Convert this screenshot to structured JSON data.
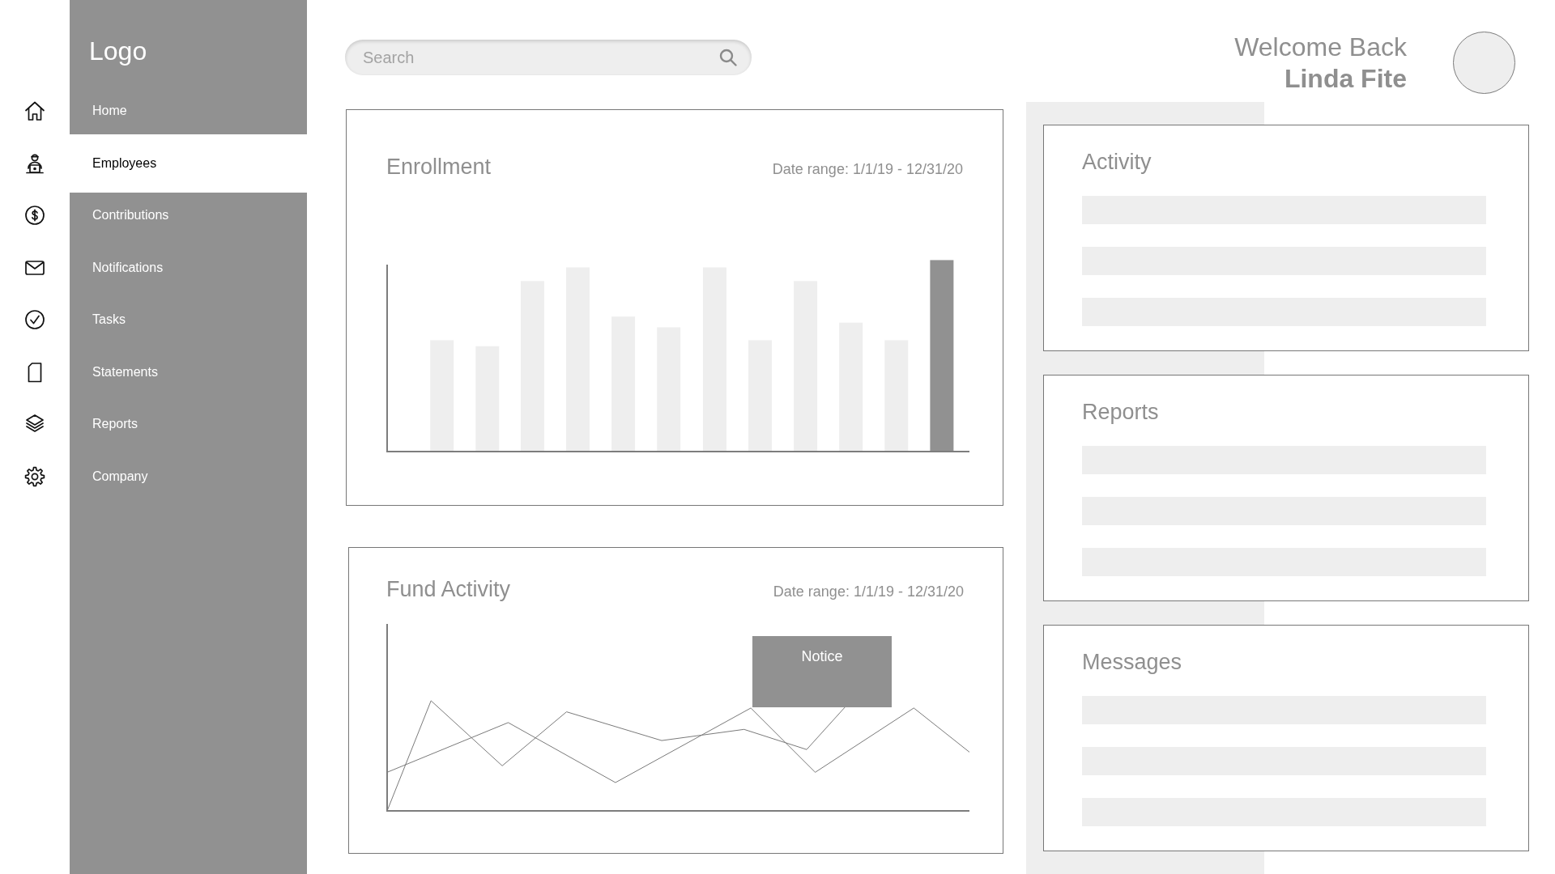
{
  "sidebar": {
    "logo": "Logo",
    "items": [
      {
        "label": "Home",
        "selected": false
      },
      {
        "label": "Employees",
        "selected": true
      },
      {
        "label": "Contributions",
        "selected": false
      },
      {
        "label": "Notifications",
        "selected": false
      },
      {
        "label": "Tasks",
        "selected": false
      },
      {
        "label": "Statements",
        "selected": false
      },
      {
        "label": "Reports",
        "selected": false
      },
      {
        "label": "Company",
        "selected": false
      }
    ]
  },
  "search": {
    "placeholder": "Search"
  },
  "user": {
    "greeting": "Welcome Back",
    "name": "Linda Fite"
  },
  "cards": [
    {
      "kind": "bar",
      "title": "Enrollment",
      "date_range": "Date range: 1/1/19 - 12/31/20"
    },
    {
      "kind": "line",
      "title": "Fund Activity",
      "date_range": "Date range: 1/1/19 - 12/31/20",
      "notice": "Notice"
    }
  ],
  "panels": [
    {
      "title": "Activity"
    },
    {
      "title": "Reports"
    },
    {
      "title": "Messages"
    }
  ]
}
